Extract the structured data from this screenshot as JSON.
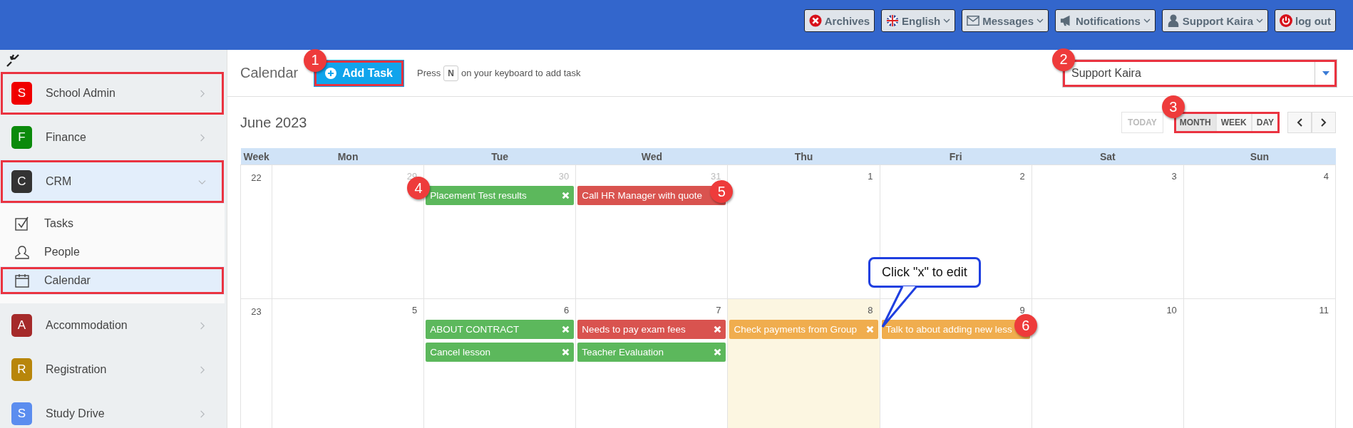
{
  "top_bar": {
    "buttons": [
      {
        "label": "Archives",
        "caret": false
      },
      {
        "label": "English",
        "caret": true
      },
      {
        "label": "Messages",
        "caret": true
      },
      {
        "label": "Notifications",
        "caret": true
      },
      {
        "label": "Support Kaira",
        "caret": true
      },
      {
        "label": "log out",
        "caret": false
      }
    ]
  },
  "sidebar": {
    "items": [
      {
        "letter": "S",
        "label": "School Admin",
        "color": "#f00000",
        "expanded": false,
        "highlighted": true
      },
      {
        "letter": "F",
        "label": "Finance",
        "color": "#0b8a0b",
        "expanded": false,
        "highlighted": false
      },
      {
        "letter": "C",
        "label": "CRM",
        "color": "#333333",
        "expanded": true,
        "highlighted": true,
        "children": [
          {
            "label": "Tasks",
            "selected": false,
            "highlighted": false
          },
          {
            "label": "People",
            "selected": false,
            "highlighted": false
          },
          {
            "label": "Calendar",
            "selected": true,
            "highlighted": true
          }
        ]
      },
      {
        "letter": "A",
        "label": "Accommodation",
        "color": "#a52a2a",
        "expanded": false,
        "highlighted": false
      },
      {
        "letter": "R",
        "label": "Registration",
        "color": "#b8860b",
        "expanded": false,
        "highlighted": false
      },
      {
        "letter": "S",
        "label": "Study Drive",
        "color": "#5b8def",
        "expanded": false,
        "highlighted": false
      }
    ]
  },
  "header": {
    "title": "Calendar",
    "add_button": {
      "label": "Add Task",
      "highlighted": true,
      "badge": "1"
    },
    "hint": {
      "before": "Press",
      "key": "N",
      "after": "on your keyboard to add task"
    },
    "user_select": {
      "value": "Support Kaira",
      "highlighted": true,
      "badge": "2"
    }
  },
  "calendar": {
    "title": "June 2023",
    "today_button": {
      "label": "TODAY",
      "disabled": true
    },
    "views": {
      "highlighted": true,
      "badge": "3",
      "items": [
        {
          "label": "MONTH",
          "selected": true
        },
        {
          "label": "WEEK",
          "selected": false
        },
        {
          "label": "DAY",
          "selected": false
        }
      ]
    },
    "columns": [
      "Week",
      "Mon",
      "Tue",
      "Wed",
      "Thu",
      "Fri",
      "Sat",
      "Sun"
    ],
    "weeks": [
      {
        "week": "22",
        "days": [
          {
            "day": "29",
            "other_month": true,
            "today": false
          },
          {
            "day": "30",
            "other_month": true,
            "today": false,
            "events": [
              {
                "title": "Placement Test results",
                "color": "#5cb85c",
                "closable": true,
                "badge": "4"
              }
            ]
          },
          {
            "day": "31",
            "other_month": true,
            "today": false,
            "events": [
              {
                "title": "Call HR Manager with quote",
                "color": "#d9534f",
                "closable": false,
                "badge": "5"
              }
            ]
          },
          {
            "day": "1",
            "other_month": false,
            "today": false
          },
          {
            "day": "2",
            "other_month": false,
            "today": false
          },
          {
            "day": "3",
            "other_month": false,
            "today": false
          },
          {
            "day": "4",
            "other_month": false,
            "today": false
          }
        ]
      },
      {
        "week": "23",
        "days": [
          {
            "day": "5",
            "other_month": false,
            "today": false
          },
          {
            "day": "6",
            "other_month": false,
            "today": false,
            "events": [
              {
                "title": "ABOUT CONTRACT",
                "color": "#5cb85c",
                "closable": true
              },
              {
                "title": "Cancel lesson",
                "color": "#5cb85c",
                "closable": true
              }
            ]
          },
          {
            "day": "7",
            "other_month": false,
            "today": false,
            "events": [
              {
                "title": "Needs to pay exam fees",
                "color": "#d9534f",
                "closable": true
              },
              {
                "title": "Teacher Evaluation",
                "color": "#5cb85c",
                "closable": true
              }
            ]
          },
          {
            "day": "8",
            "other_month": false,
            "today": true,
            "events": [
              {
                "title": "Check payments from Group",
                "color": "#f0ad4e",
                "closable": true,
                "callout": "Click \"x\" to edit"
              }
            ]
          },
          {
            "day": "9",
            "other_month": false,
            "today": false,
            "events": [
              {
                "title": "Talk to about adding new less",
                "color": "#f0ad4e",
                "closable": false,
                "badge": "6"
              }
            ]
          },
          {
            "day": "10",
            "other_month": false,
            "today": false
          },
          {
            "day": "11",
            "other_month": false,
            "today": false
          }
        ]
      }
    ]
  }
}
